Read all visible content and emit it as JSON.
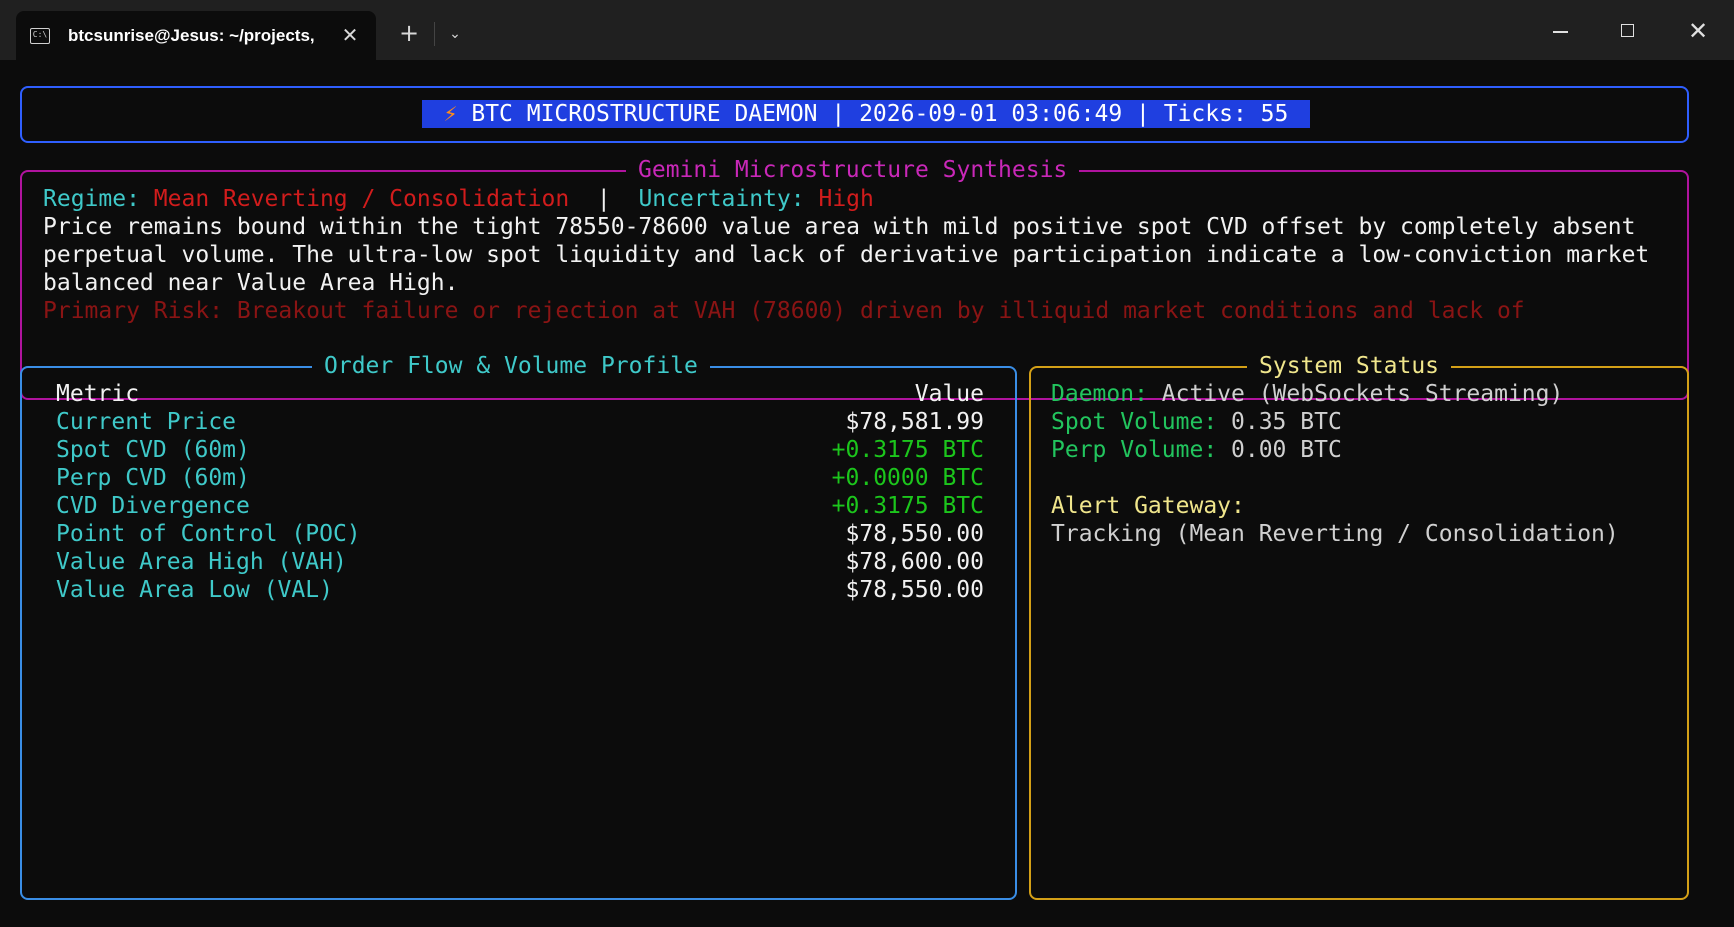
{
  "titlebar": {
    "tab_title": "btcsunrise@Jesus: ~/projects,",
    "tab_icon_glyph": "C:\\",
    "close_glyph": "✕",
    "new_tab_glyph": "+",
    "dropdown_glyph": "⌄",
    "win_close_glyph": "✕"
  },
  "header": {
    "bolt": "⚡",
    "text": " BTC MICROSTRUCTURE DAEMON | 2026-09-01 03:06:49 | Ticks: 55"
  },
  "gemini": {
    "title": "Gemini Microstructure Synthesis",
    "regime_label": "Regime: ",
    "regime_value": "Mean Reverting / Consolidation",
    "separator": "  |  ",
    "uncertainty_label": "Uncertainty: ",
    "uncertainty_value": "High",
    "summary_lines": [
      "Price remains bound within the tight 78550-78600 value area with mild positive spot CVD offset by completely absent",
      "perpetual volume. The ultra-low spot liquidity and lack of derivative participation indicate a low-conviction market",
      "balanced near Value Area High."
    ],
    "risk_line": "Primary Risk: Breakout failure or rejection at VAH (78600) driven by illiquid market conditions and lack of"
  },
  "order_flow": {
    "title": "Order Flow & Volume Profile",
    "header_metric": "Metric",
    "header_value": "Value",
    "rows": [
      {
        "metric": "Current Price",
        "value": "$78,581.99"
      },
      {
        "metric": "Spot CVD (60m)",
        "value": "+0.3175 BTC"
      },
      {
        "metric": "Perp CVD (60m)",
        "value": "+0.0000 BTC"
      },
      {
        "metric": "CVD Divergence",
        "value": "+0.3175 BTC"
      },
      {
        "metric": "Point of Control (POC)",
        "value": "$78,550.00"
      },
      {
        "metric": "Value Area High (VAH)",
        "value": "$78,600.00"
      },
      {
        "metric": "Value Area Low (VAL)",
        "value": "$78,550.00"
      }
    ]
  },
  "status": {
    "title": "System Status",
    "daemon_label": "Daemon: ",
    "daemon_value": "Active (WebSockets Streaming)",
    "spot_label": "Spot Volume: ",
    "spot_value": "0.35 BTC",
    "perp_label": "Perp Volume: ",
    "perp_value": "0.00 BTC",
    "gateway_label": "Alert Gateway:",
    "gateway_value": "Tracking (Mean Reverting / Consolidation)"
  },
  "colors": {
    "background": "#0c0c0c",
    "header_border": "#2f5fff",
    "header_highlight": "#1f3fe0",
    "gemini_border": "#b0139e",
    "order_border": "#3a8ee6",
    "status_border": "#d4a017",
    "cyan": "#3fc9c9",
    "red": "#d11c1c",
    "green": "#1cc61c",
    "yellow": "#f0e68c"
  }
}
